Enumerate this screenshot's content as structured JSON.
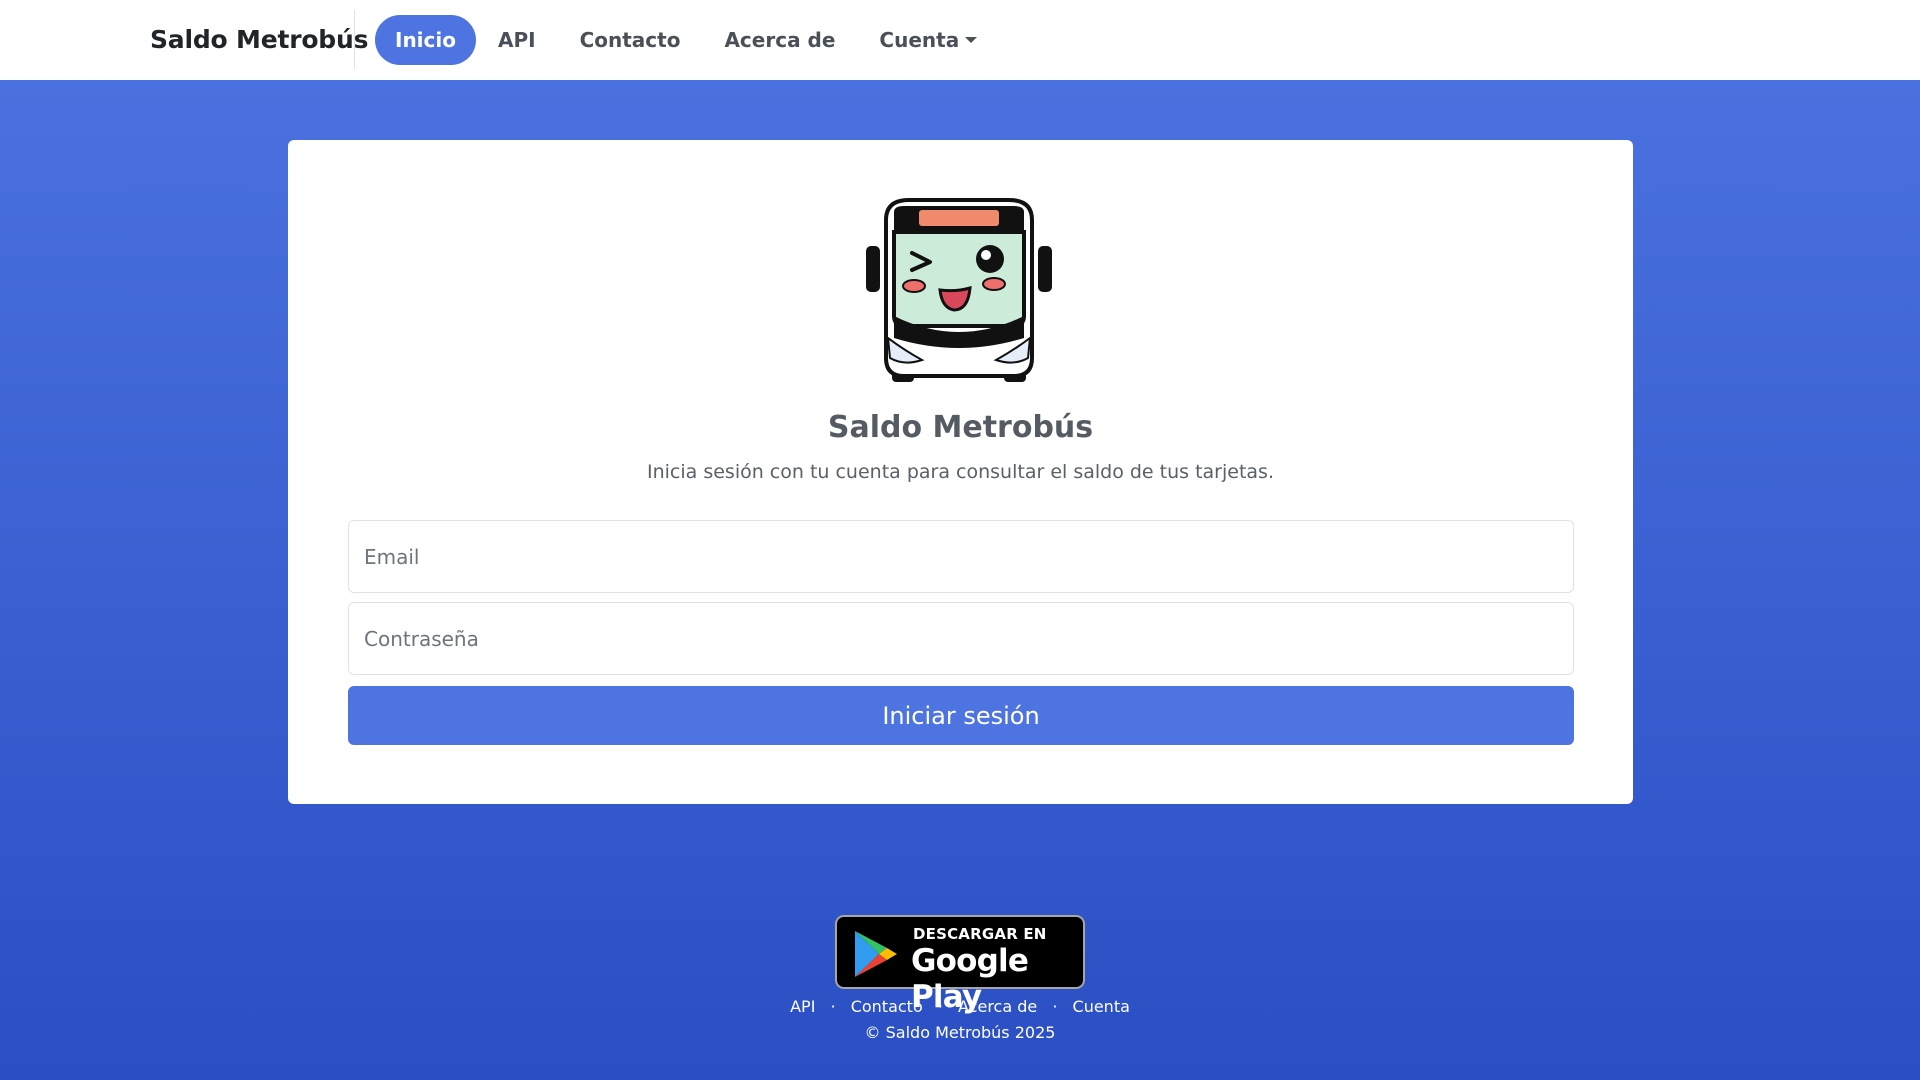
{
  "navbar": {
    "brand": "Saldo Metrobús",
    "items": [
      {
        "label": "Inicio",
        "active": true
      },
      {
        "label": "API",
        "active": false
      },
      {
        "label": "Contacto",
        "active": false
      },
      {
        "label": "Acerca de",
        "active": false
      },
      {
        "label": "Cuenta",
        "active": false,
        "dropdown": true
      }
    ]
  },
  "login": {
    "title": "Saldo Metrobús",
    "subtitle": "Inicia sesión con tu cuenta para consultar el saldo de tus tarjetas.",
    "email": {
      "placeholder": "Email",
      "value": ""
    },
    "password": {
      "placeholder": "Contraseña",
      "value": ""
    },
    "submit_label": "Iniciar sesión"
  },
  "footer": {
    "store_badge": {
      "top": "DESCARGAR EN",
      "bottom": "Google Play"
    },
    "links": [
      "API",
      "Contacto",
      "Acerca de",
      "Cuenta"
    ],
    "separator": "·",
    "copyright": "© Saldo Metrobús 2025"
  },
  "colors": {
    "primary": "#4d74e1",
    "background_gradient_end": "#2a4fc4"
  },
  "icons": {
    "mascot": "winking-bus-mascot",
    "caret": "caret-down-icon",
    "store": "google-play-icon"
  }
}
